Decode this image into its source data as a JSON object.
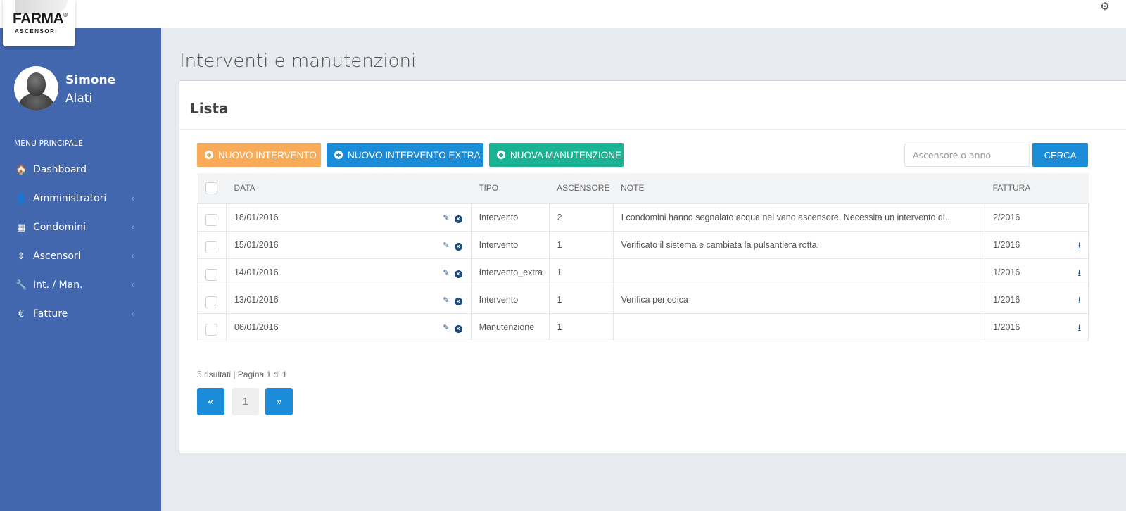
{
  "logo": {
    "brand": "FARMA",
    "reg": "®",
    "sub": "ASCENSORI"
  },
  "topbar": {
    "settings_icon": "gear-icon"
  },
  "user": {
    "first_name": "Simone",
    "last_name": "Alati"
  },
  "sidebar": {
    "menu_title": "MENU PRINCIPALE",
    "items": [
      {
        "label": "Dashboard",
        "icon": "home-icon",
        "glyph": "🏠",
        "chevron": false
      },
      {
        "label": "Amministratori",
        "icon": "user-icon",
        "glyph": "👤",
        "chevron": true
      },
      {
        "label": "Condomini",
        "icon": "building-icon",
        "glyph": "▦",
        "chevron": true
      },
      {
        "label": "Ascensori",
        "icon": "sort-icon",
        "glyph": "⇕",
        "chevron": true
      },
      {
        "label": "Int. / Man.",
        "icon": "wrench-icon",
        "glyph": "🔧",
        "chevron": true
      },
      {
        "label": "Fatture",
        "icon": "euro-icon",
        "glyph": "€",
        "chevron": true
      }
    ]
  },
  "page": {
    "title": "Interventi e manutenzioni"
  },
  "panel": {
    "title": "Lista"
  },
  "toolbar": {
    "new_intervento": "NUOVO INTERVENTO",
    "new_intervento_extra": "NUOVO INTERVENTO EXTRA",
    "new_manutenzione": "NUOVA MANUTENZIONE",
    "search_placeholder": "Ascensore o anno",
    "search_value": "",
    "search_button": "CERCA"
  },
  "table": {
    "columns": {
      "data": "DATA",
      "tipo": "TIPO",
      "ascensore": "ASCENSORE",
      "note": "NOTE",
      "fattura": "FATTURA"
    },
    "rows": [
      {
        "data": "18/01/2016",
        "tipo": "Intervento",
        "ascensore": "2",
        "note": "I condomini hanno segnalato acqua nel vano ascensore. Necessita un intervento di...",
        "fattura": "2/2016",
        "download": false
      },
      {
        "data": "15/01/2016",
        "tipo": "Intervento",
        "ascensore": "1",
        "note": "Verificato il sistema e cambiata la pulsantiera rotta.",
        "fattura": "1/2016",
        "download": true
      },
      {
        "data": "14/01/2016",
        "tipo": "Intervento_extra",
        "ascensore": "1",
        "note": "",
        "fattura": "1/2016",
        "download": true
      },
      {
        "data": "13/01/2016",
        "tipo": "Intervento",
        "ascensore": "1",
        "note": "Verifica periodica",
        "fattura": "1/2016",
        "download": true
      },
      {
        "data": "06/01/2016",
        "tipo": "Manutenzione",
        "ascensore": "1",
        "note": "",
        "fattura": "1/2016",
        "download": true
      }
    ]
  },
  "pagination": {
    "summary": "5 risultati | Pagina 1 di 1",
    "prev": "«",
    "current": "1",
    "next": "»"
  }
}
